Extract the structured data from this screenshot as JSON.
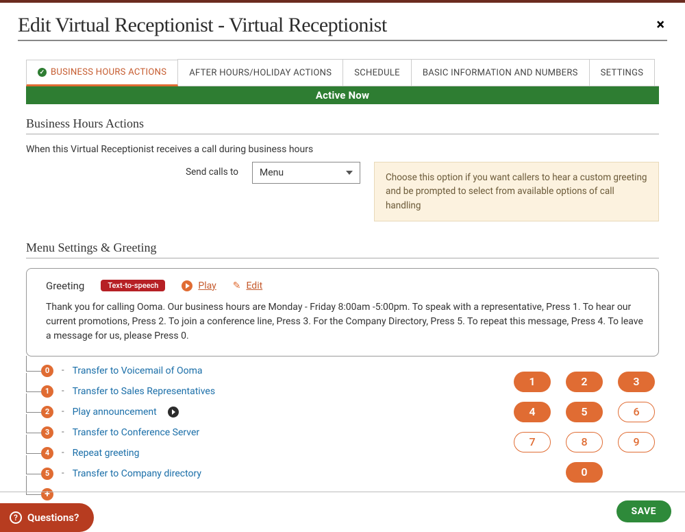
{
  "header": {
    "title": "Edit Virtual Receptionist - Virtual Receptionist"
  },
  "tabs": [
    {
      "label": "BUSINESS HOURS ACTIONS",
      "active": true,
      "check": true
    },
    {
      "label": "AFTER HOURS/HOLIDAY ACTIONS"
    },
    {
      "label": "SCHEDULE"
    },
    {
      "label": "BASIC INFORMATION AND NUMBERS"
    },
    {
      "label": "SETTINGS"
    }
  ],
  "banner": "Active Now",
  "section1_title": "Business Hours Actions",
  "intro": "When this Virtual Receptionist receives a call during business hours",
  "send_calls_label": "Send calls to",
  "send_calls_value": "Menu",
  "help_text": "Choose this option if you want callers to hear a custom greeting and be prompted to select from available options of call handling",
  "section2_title": "Menu Settings & Greeting",
  "greeting": {
    "label": "Greeting",
    "badge": "Text-to-speech",
    "play": "Play",
    "edit": "Edit",
    "body": "Thank you for calling Ooma. Our business hours are Monday - Friday 8:00am -5:00pm. To speak with a representative, Press 1. To hear our current promotions, Press 2. To join a conference line, Press 3. For the Company Directory, Press 5. To repeat this message, Press 4. To leave a message for us, please Press 0."
  },
  "menu_rows": [
    {
      "digit": "0",
      "prefix": "Transfer to Voicemail of ",
      "target": "Ooma"
    },
    {
      "digit": "1",
      "prefix": "Transfer to ",
      "target": "Sales Representatives"
    },
    {
      "digit": "2",
      "prefix": "Play announcement",
      "target": "",
      "playable": true
    },
    {
      "digit": "3",
      "prefix": "Transfer to Conference Server",
      "target": ""
    },
    {
      "digit": "4",
      "prefix": "Repeat greeting",
      "target": ""
    },
    {
      "digit": "5",
      "prefix": "Transfer to Company directory",
      "target": ""
    }
  ],
  "keypad": {
    "keys": [
      {
        "n": "1",
        "filled": true
      },
      {
        "n": "2",
        "filled": true
      },
      {
        "n": "3",
        "filled": true
      },
      {
        "n": "4",
        "filled": true
      },
      {
        "n": "5",
        "filled": true
      },
      {
        "n": "6",
        "filled": false
      },
      {
        "n": "7",
        "filled": false
      },
      {
        "n": "8",
        "filled": false
      },
      {
        "n": "9",
        "filled": false
      }
    ],
    "zero": {
      "n": "0",
      "filled": true
    }
  },
  "footer": {
    "questions": "Questions?",
    "save": "SAVE"
  }
}
